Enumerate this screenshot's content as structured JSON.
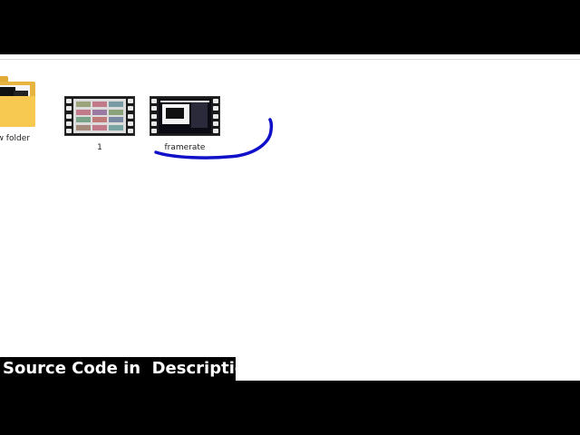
{
  "explorer": {
    "items": [
      {
        "label": "ew folder",
        "type": "folder"
      },
      {
        "label": "1",
        "type": "video"
      },
      {
        "label": "framerate",
        "type": "video"
      }
    ]
  },
  "banner": {
    "text": "Source Code in  Description"
  },
  "colors": {
    "annotation_stroke": "#1010c8",
    "folder": "#f7c950",
    "background": "#ffffff"
  }
}
